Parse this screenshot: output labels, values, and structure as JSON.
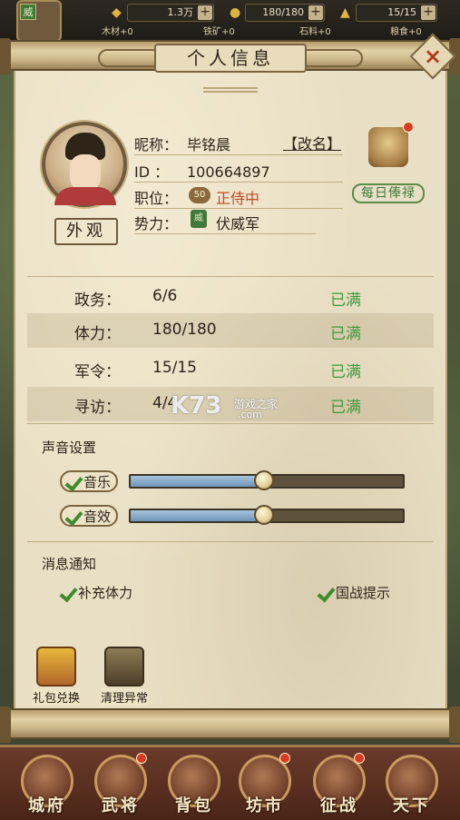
{
  "top_bar": {
    "tag": "威",
    "resources": [
      {
        "icon": "gold-ingot-icon",
        "value": "1.3万"
      },
      {
        "icon": "rice-bowl-icon",
        "value": "180/180"
      },
      {
        "icon": "tent-icon",
        "value": "15/15"
      }
    ],
    "materials": [
      {
        "icon": "wood-icon",
        "value": "木材+0"
      },
      {
        "icon": "iron-icon",
        "value": "铁矿+0"
      },
      {
        "icon": "stone-icon",
        "value": "石料+0"
      },
      {
        "icon": "grain-icon",
        "value": "粮食+0"
      }
    ]
  },
  "panel": {
    "title": "个人信息",
    "close_label": "×",
    "appearance_button": "外观",
    "rename_button": "【改名】",
    "daily_salary_button": "每日俸禄",
    "profile": {
      "nickname_label": "昵称：",
      "nickname": "毕铭晨",
      "id_label": "ID   ：",
      "id": "100664897",
      "rank_label": "职位：",
      "rank_badge": "50",
      "rank": "正侍中",
      "faction_label": "势力：",
      "faction_badge": "威",
      "faction": "伏威军"
    },
    "stats": [
      {
        "label": "政务：",
        "value": "6/6",
        "status": "已满"
      },
      {
        "label": "体力：",
        "value": "180/180",
        "status": "已满"
      },
      {
        "label": "军令：",
        "value": "15/15",
        "status": "已满"
      },
      {
        "label": "寻访：",
        "value": "4/4",
        "status": "已满"
      }
    ],
    "sound": {
      "title": "声音设置",
      "music_label": "音乐",
      "music_level": 0.49,
      "effects_label": "音效",
      "effects_level": 0.49
    },
    "notifications": {
      "title": "消息通知",
      "stamina_label": "补充体力",
      "war_label": "国战提示"
    },
    "tools": [
      {
        "icon": "gift-box-icon",
        "label": "礼包兑换"
      },
      {
        "icon": "broom-icon",
        "label": "清理异常"
      }
    ]
  },
  "watermark": {
    "logo": "K73",
    "text": "游戏之家",
    "domain": ".com"
  },
  "nav": [
    {
      "icon": "city-icon",
      "label": "城府"
    },
    {
      "icon": "general-icon",
      "label": "武将"
    },
    {
      "icon": "bag-icon",
      "label": "背包"
    },
    {
      "icon": "market-icon",
      "label": "坊市"
    },
    {
      "icon": "battle-icon",
      "label": "征战"
    },
    {
      "icon": "world-icon",
      "label": "天下"
    }
  ],
  "colors": {
    "accent_green": "#3f9a3a",
    "rank_red": "#c04a2a",
    "parchment": "#e9dfc4"
  }
}
